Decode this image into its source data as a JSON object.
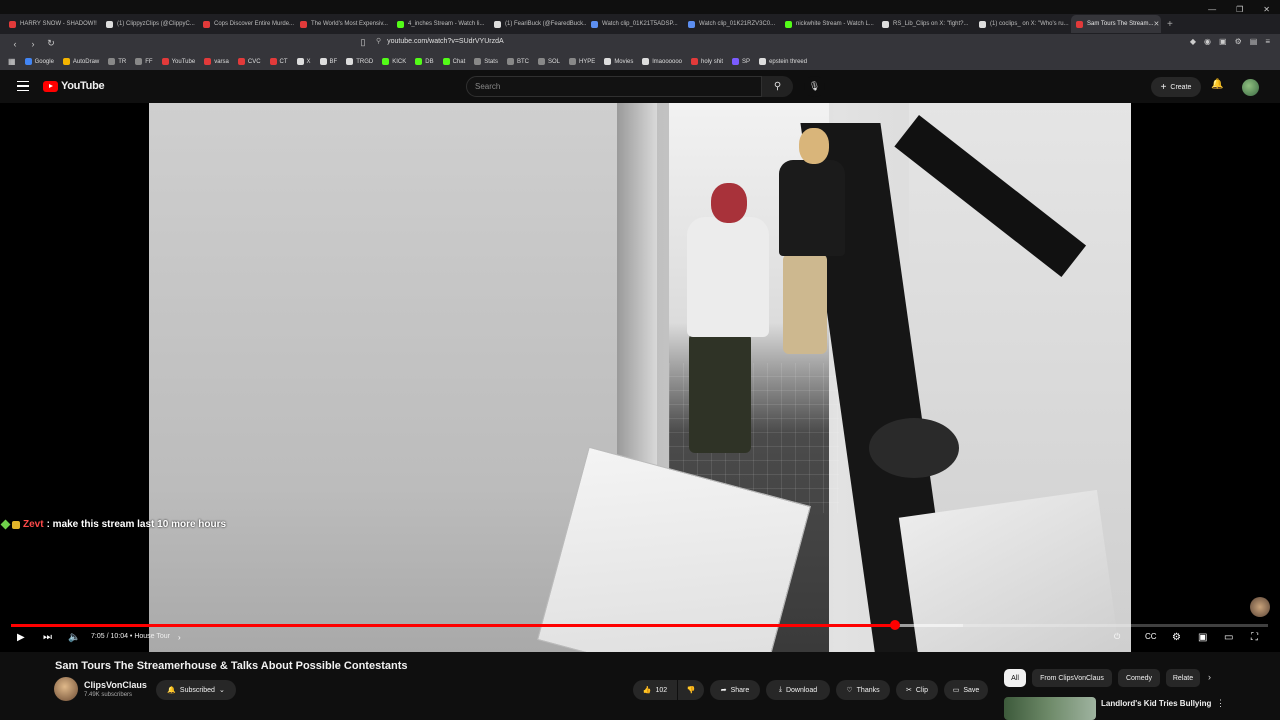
{
  "browser": {
    "tabs": [
      {
        "label": "HARRY SNOW - SHADOW!!",
        "color": "#e23a3a"
      },
      {
        "label": "(1) ClippyzClips (@ClippyC...",
        "color": "#dddddd"
      },
      {
        "label": "Cops Discover Entire Murde...",
        "color": "#e23a3a"
      },
      {
        "label": "The World's Most Expensiv...",
        "color": "#e23a3a"
      },
      {
        "label": "4_inches Stream - Watch li...",
        "color": "#53fc18"
      },
      {
        "label": "(1) FeariBuck (@FearedBuck...",
        "color": "#dddddd"
      },
      {
        "label": "Watch clip_01K21T5ADSP...",
        "color": "#5c8ef0"
      },
      {
        "label": "Watch clip_01K21RZV3C0...",
        "color": "#5c8ef0"
      },
      {
        "label": "nickwhite Stream - Watch L...",
        "color": "#53fc18"
      },
      {
        "label": "RS_Lib_Clips on X: \"fight?...",
        "color": "#dddddd"
      },
      {
        "label": "(1) coclips_ on X: \"Who's ru...",
        "color": "#dddddd"
      },
      {
        "label": "Sam Tours The Stream...",
        "color": "#e23a3a",
        "active": true
      }
    ],
    "new_tab": "+",
    "url": "youtube.com/watch?v=SUdrVYUrzdA",
    "bookmarks": [
      {
        "label": "Google",
        "color": "#4285f4"
      },
      {
        "label": "AutoDraw",
        "color": "#f4b400"
      },
      {
        "label": "TR",
        "color": "#888888"
      },
      {
        "label": "FF",
        "color": "#888888"
      },
      {
        "label": "YouTube",
        "color": "#e23a3a"
      },
      {
        "label": "varsa",
        "color": "#e23a3a"
      },
      {
        "label": "CVC",
        "color": "#e23a3a"
      },
      {
        "label": "CT",
        "color": "#e23a3a"
      },
      {
        "label": "X",
        "color": "#dddddd"
      },
      {
        "label": "BF",
        "color": "#dddddd"
      },
      {
        "label": "TRGD",
        "color": "#dddddd"
      },
      {
        "label": "KICK",
        "color": "#53fc18"
      },
      {
        "label": "DB",
        "color": "#53fc18"
      },
      {
        "label": "Chat",
        "color": "#53fc18"
      },
      {
        "label": "Stats",
        "color": "#888888"
      },
      {
        "label": "BTC",
        "color": "#888888"
      },
      {
        "label": "SOL",
        "color": "#888888"
      },
      {
        "label": "HYPE",
        "color": "#888888"
      },
      {
        "label": "Movies",
        "color": "#dddddd"
      },
      {
        "label": "lmaoooooo",
        "color": "#dddddd"
      },
      {
        "label": "holy shit",
        "color": "#e23a3a"
      },
      {
        "label": "SP",
        "color": "#7b5cff"
      },
      {
        "label": "epstein threed",
        "color": "#dddddd"
      }
    ]
  },
  "header": {
    "logo_text": "YouTube",
    "search_placeholder": "Search",
    "create_label": "Create"
  },
  "player": {
    "chat_user": "Zevt",
    "chat_message": ": make this stream last 10 more hours",
    "time_display": "7:05 / 10:04 • House Tour",
    "progress_fraction": 0.7035,
    "buffer_fraction": 0.757,
    "accent": "#ff0000"
  },
  "video": {
    "title": "Sam Tours The Streamerhouse & Talks About Possible Contestants",
    "channel_name": "ClipsVonClaus",
    "channel_subs": "7.49K subscribers",
    "subscribed_label": "Subscribed",
    "like_count": "102",
    "share_label": "Share",
    "download_label": "Download",
    "thanks_label": "Thanks",
    "clip_label": "Clip",
    "save_label": "Save"
  },
  "related": {
    "chips": [
      "All",
      "From ClipsVonClaus",
      "Comedy",
      "Relate"
    ],
    "first_title": "Landlord's Kid Tries Bullying"
  }
}
